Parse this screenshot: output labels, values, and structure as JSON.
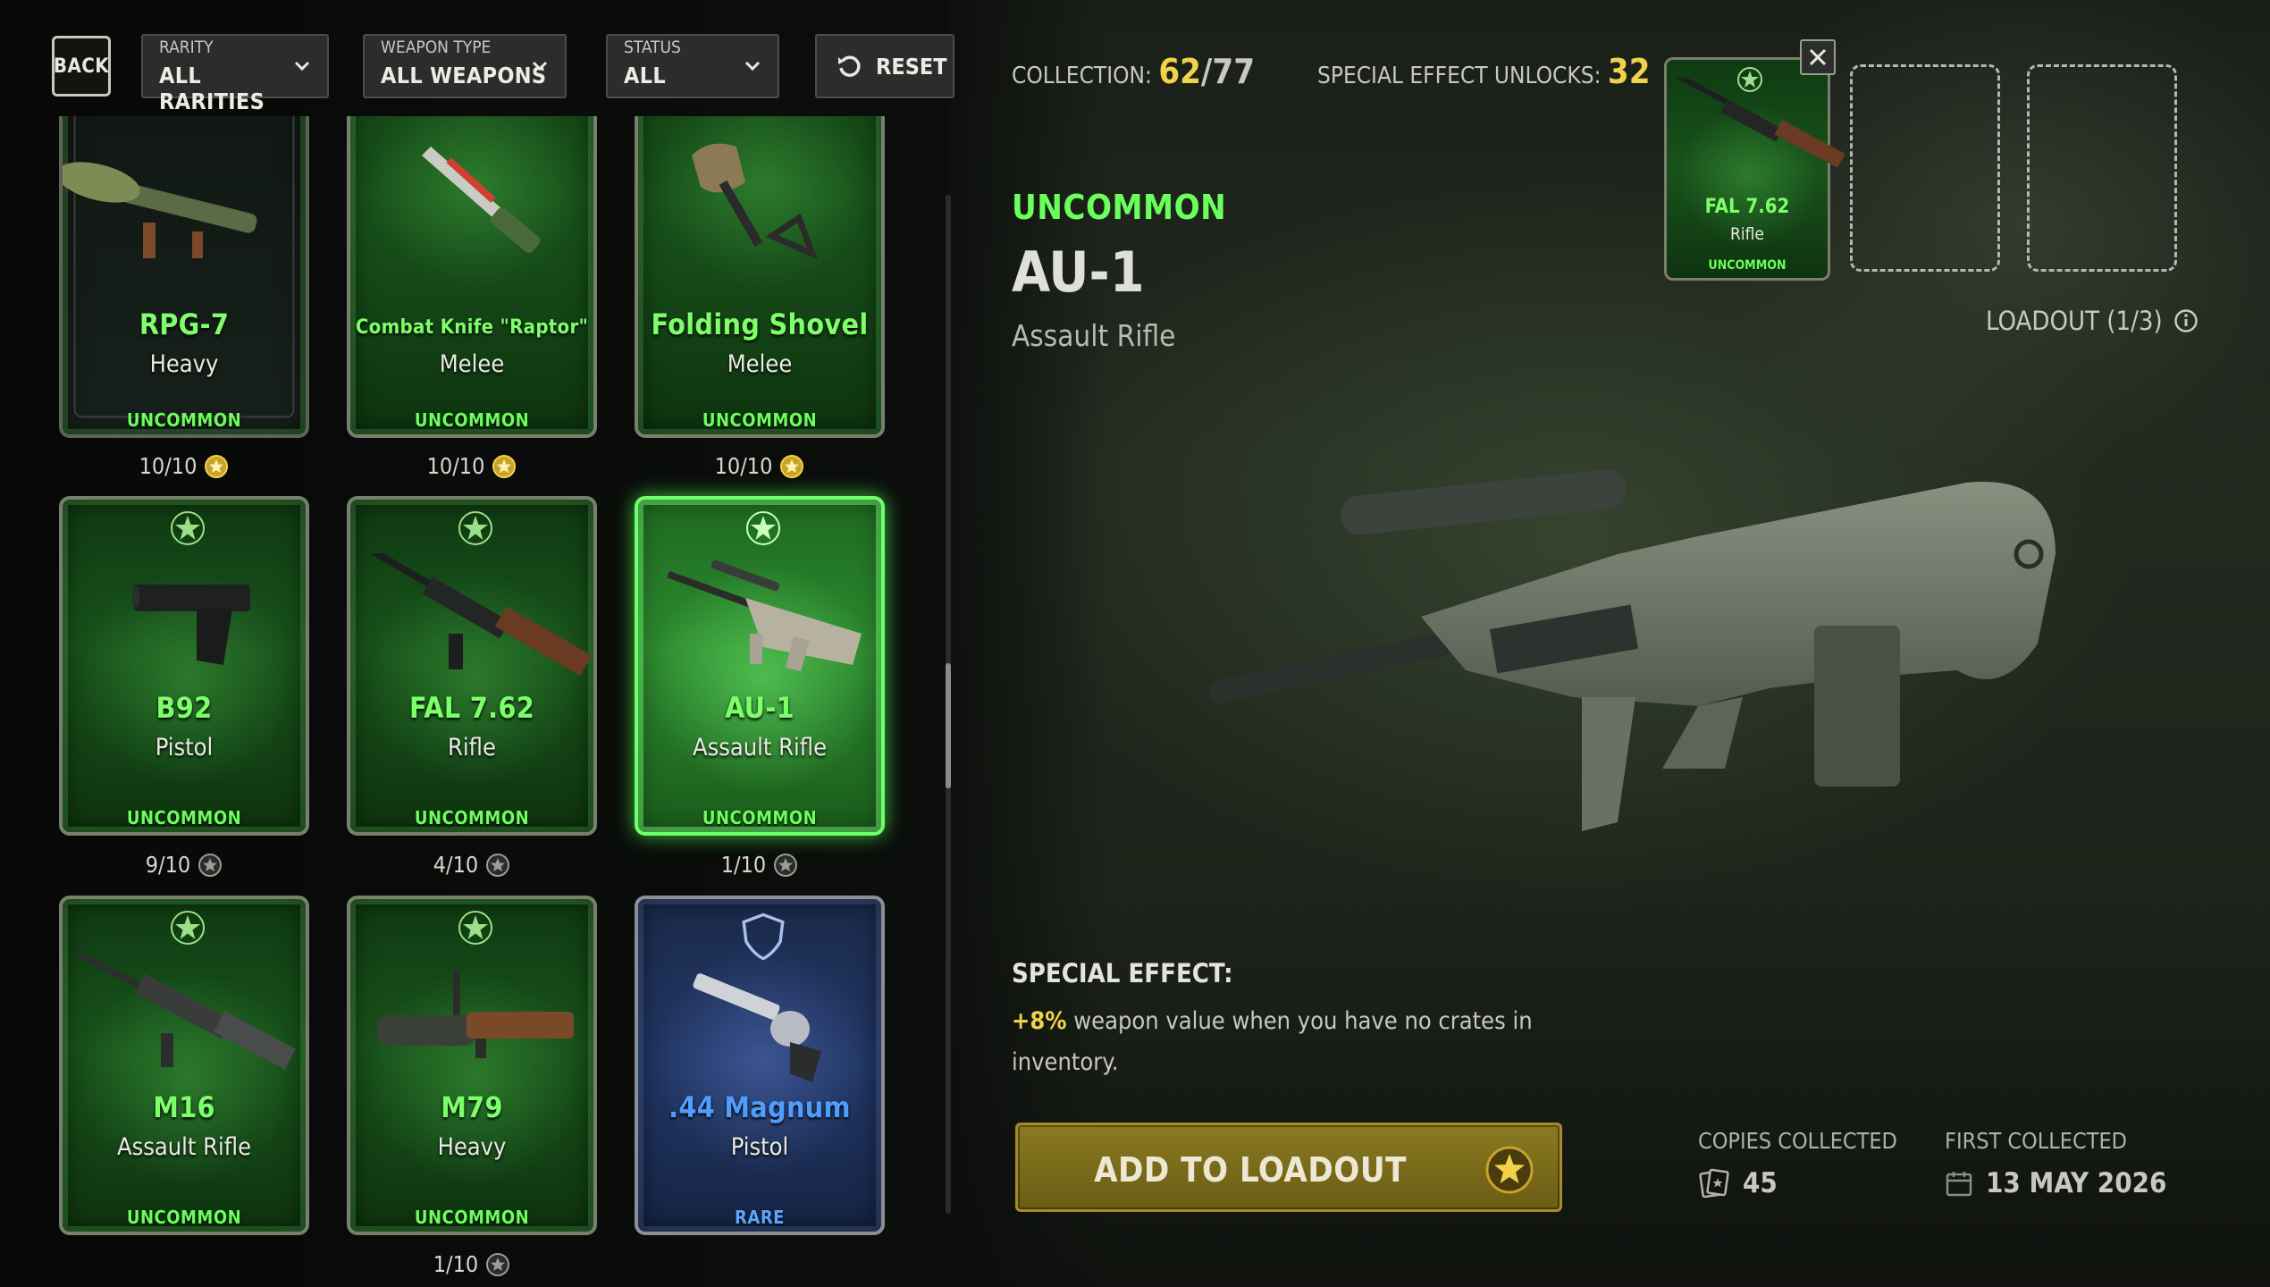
{
  "filters": {
    "back_label": "BACK",
    "rarity": {
      "label": "RARITY",
      "value": "ALL RARITIES"
    },
    "weapon_type": {
      "label": "WEAPON TYPE",
      "value": "ALL WEAPONS"
    },
    "status": {
      "label": "STATUS",
      "value": "ALL"
    },
    "reset_label": "RESET"
  },
  "cards": [
    {
      "name": "RPG-7",
      "type": "Heavy",
      "rarity": "UNCOMMON",
      "count": "10/10"
    },
    {
      "name": "Combat Knife \"Raptor\"",
      "type": "Melee",
      "rarity": "UNCOMMON",
      "count": "10/10"
    },
    {
      "name": "Folding Shovel",
      "type": "Melee",
      "rarity": "UNCOMMON",
      "count": "10/10"
    },
    {
      "name": "B92",
      "type": "Pistol",
      "rarity": "UNCOMMON",
      "count": "9/10"
    },
    {
      "name": "FAL 7.62",
      "type": "Rifle",
      "rarity": "UNCOMMON",
      "count": "4/10"
    },
    {
      "name": "AU-1",
      "type": "Assault Rifle",
      "rarity": "UNCOMMON",
      "count": "1/10"
    },
    {
      "name": "M16",
      "type": "Assault Rifle",
      "rarity": "UNCOMMON",
      "count": ""
    },
    {
      "name": "M79",
      "type": "Heavy",
      "rarity": "UNCOMMON",
      "count": "1/10"
    },
    {
      "name": ".44 Magnum",
      "type": "Pistol",
      "rarity": "RARE",
      "count": ""
    }
  ],
  "stats": {
    "collection_label": "COLLECTION:",
    "collection_owned": "62",
    "collection_total": "77",
    "unlocks_label": "SPECIAL EFFECT UNLOCKS:",
    "unlocks_value": "32"
  },
  "detail": {
    "rarity": "UNCOMMON",
    "name": "AU-1",
    "type": "Assault Rifle",
    "special_effect_title": "SPECIAL EFFECT:",
    "special_effect_pct": "+8%",
    "special_effect_text": " weapon value when you have no crates in inventory.",
    "add_button": "ADD TO LOADOUT",
    "copies_label": "COPIES COLLECTED",
    "copies_value": "45",
    "first_label": "FIRST COLLECTED",
    "first_value": "13 MAY 2026"
  },
  "loadout": {
    "slot1": {
      "name": "FAL 7.62",
      "type": "Rifle",
      "rarity": "UNCOMMON"
    },
    "label": "LOADOUT (1/3)"
  },
  "colors": {
    "uncommon": "#6aff5a",
    "rare": "#4f9dff",
    "gold": "#f2d24a"
  }
}
